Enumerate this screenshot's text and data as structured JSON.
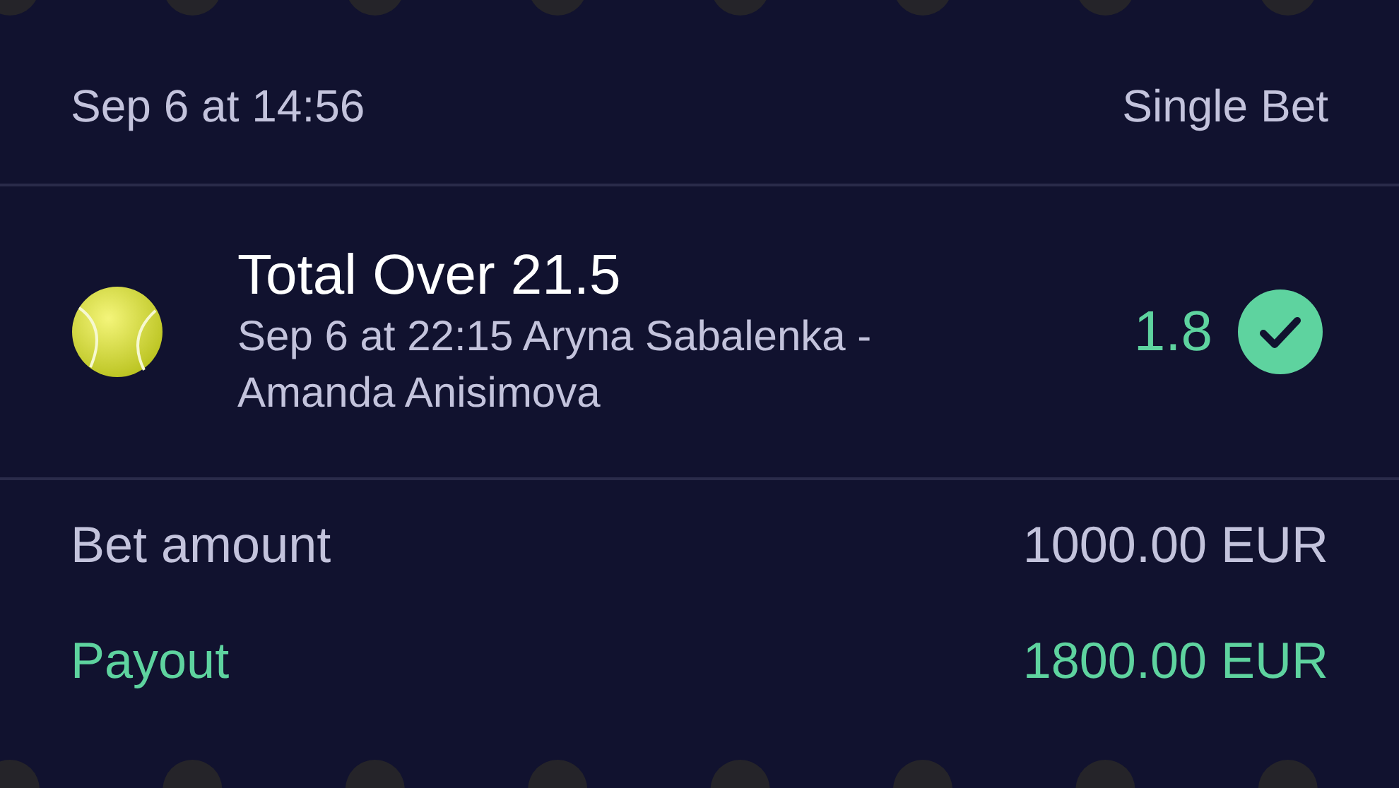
{
  "header": {
    "placed_at": "Sep 6 at 14:56",
    "bet_type": "Single Bet"
  },
  "selection": {
    "market": "Total Over 21.5",
    "event": "Sep 6 at 22:15 Aryna Sabalenka - Amanda Anisimova",
    "odds": "1.8",
    "won": true
  },
  "amounts": [
    {
      "kind": "stake",
      "label": "Bet amount",
      "value": "1000.00 EUR"
    },
    {
      "kind": "payout",
      "label": "Payout",
      "value": "1800.00 EUR"
    }
  ]
}
